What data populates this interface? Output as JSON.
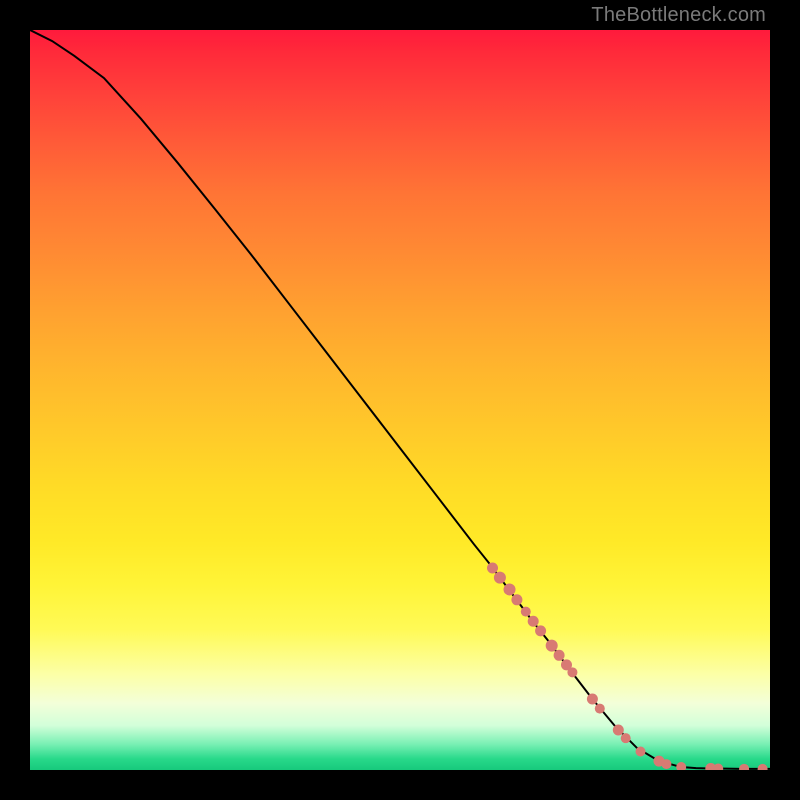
{
  "watermark": "TheBottleneck.com",
  "colors": {
    "background": "#000000",
    "curve": "#000000",
    "marker_fill": "#d87a73",
    "marker_stroke": "#d87a73"
  },
  "chart_data": {
    "type": "line",
    "title": "",
    "xlabel": "",
    "ylabel": "",
    "xlim": [
      0,
      100
    ],
    "ylim": [
      0,
      100
    ],
    "grid": false,
    "series": [
      {
        "name": "curve",
        "kind": "line",
        "x": [
          0,
          3,
          6,
          10,
          15,
          20,
          25,
          30,
          35,
          40,
          45,
          50,
          55,
          60,
          62,
          65,
          68,
          70,
          73,
          76,
          79,
          82,
          85,
          88,
          90,
          92,
          94,
          96,
          98,
          100
        ],
        "y": [
          100,
          98.5,
          96.5,
          93.5,
          88,
          82,
          75.8,
          69.5,
          63,
          56.5,
          50,
          43.5,
          37,
          30.5,
          28,
          24,
          20,
          17.5,
          13.5,
          9.6,
          6,
          3,
          1.2,
          0.4,
          0.25,
          0.2,
          0.18,
          0.16,
          0.15,
          0.15
        ]
      },
      {
        "name": "highlight-markers",
        "kind": "scatter",
        "points": [
          {
            "x": 62.5,
            "y": 27.3,
            "r": 5.5
          },
          {
            "x": 63.5,
            "y": 26.0,
            "r": 6.0
          },
          {
            "x": 64.8,
            "y": 24.4,
            "r": 6.0
          },
          {
            "x": 65.8,
            "y": 23.0,
            "r": 5.5
          },
          {
            "x": 67.0,
            "y": 21.4,
            "r": 5.0
          },
          {
            "x": 68.0,
            "y": 20.1,
            "r": 5.5
          },
          {
            "x": 69.0,
            "y": 18.8,
            "r": 5.5
          },
          {
            "x": 70.5,
            "y": 16.8,
            "r": 6.0
          },
          {
            "x": 71.5,
            "y": 15.5,
            "r": 5.5
          },
          {
            "x": 72.5,
            "y": 14.2,
            "r": 5.5
          },
          {
            "x": 73.3,
            "y": 13.2,
            "r": 5.0
          },
          {
            "x": 76.0,
            "y": 9.6,
            "r": 5.5
          },
          {
            "x": 77.0,
            "y": 8.3,
            "r": 5.0
          },
          {
            "x": 79.5,
            "y": 5.4,
            "r": 5.5
          },
          {
            "x": 80.5,
            "y": 4.3,
            "r": 5.0
          },
          {
            "x": 82.5,
            "y": 2.5,
            "r": 5.0
          },
          {
            "x": 85.0,
            "y": 1.2,
            "r": 5.5
          },
          {
            "x": 86.0,
            "y": 0.8,
            "r": 5.0
          },
          {
            "x": 88.0,
            "y": 0.4,
            "r": 5.0
          },
          {
            "x": 92.0,
            "y": 0.2,
            "r": 5.5
          },
          {
            "x": 93.0,
            "y": 0.2,
            "r": 5.0
          },
          {
            "x": 96.5,
            "y": 0.16,
            "r": 5.0
          },
          {
            "x": 99.0,
            "y": 0.15,
            "r": 5.0
          }
        ]
      }
    ]
  }
}
